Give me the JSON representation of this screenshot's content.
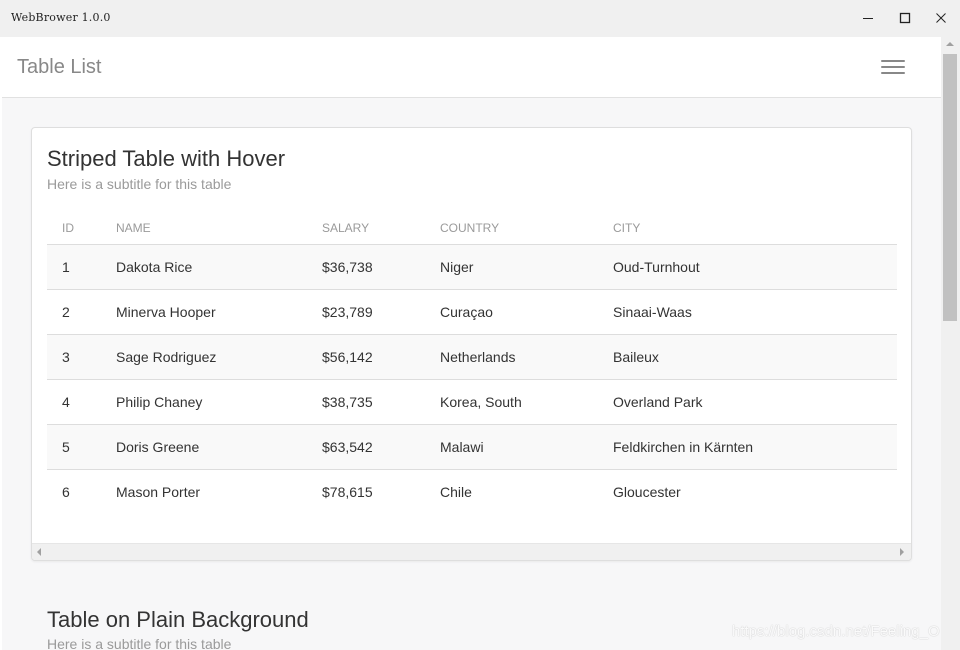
{
  "window": {
    "title": "WebBrower 1.0.0"
  },
  "navbar": {
    "title": "Table List",
    "menu_icon": "hamburger-menu-icon"
  },
  "striped_table": {
    "title": "Striped Table with Hover",
    "subtitle": "Here is a subtitle for this table",
    "columns": [
      "ID",
      "NAME",
      "SALARY",
      "COUNTRY",
      "CITY"
    ],
    "rows": [
      [
        "1",
        "Dakota Rice",
        "$36,738",
        "Niger",
        "Oud-Turnhout"
      ],
      [
        "2",
        "Minerva Hooper",
        "$23,789",
        "Curaçao",
        "Sinaai-Waas"
      ],
      [
        "3",
        "Sage Rodriguez",
        "$56,142",
        "Netherlands",
        "Baileux"
      ],
      [
        "4",
        "Philip Chaney",
        "$38,735",
        "Korea, South",
        "Overland Park"
      ],
      [
        "5",
        "Doris Greene",
        "$63,542",
        "Malawi",
        "Feldkirchen in Kärnten"
      ],
      [
        "6",
        "Mason Porter",
        "$78,615",
        "Chile",
        "Gloucester"
      ]
    ]
  },
  "plain_table": {
    "title": "Table on Plain Background",
    "subtitle": "Here is a subtitle for this table"
  },
  "watermark": "https://blog.csdn.net/Feeling_O",
  "colors": {
    "titlebar_bg": "#f0f0f0",
    "page_bg": "#f7f7f8",
    "muted_text": "#9a9a9a",
    "stripe": "#f9f9f9"
  }
}
